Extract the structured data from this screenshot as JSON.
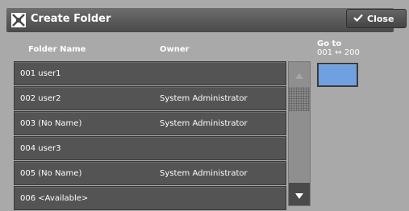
{
  "window": {
    "title": "Create Folder"
  },
  "toolbar": {
    "close_label": "Close"
  },
  "columns": {
    "folder_name": "Folder Name",
    "owner": "Owner"
  },
  "goto": {
    "label": "Go to",
    "range": "001 ↔ 200"
  },
  "folders": [
    {
      "name": "001  user1",
      "owner": ""
    },
    {
      "name": "002  user2",
      "owner": "System Administrator"
    },
    {
      "name": "003  (No Name)",
      "owner": "System Administrator"
    },
    {
      "name": "004  user3",
      "owner": ""
    },
    {
      "name": "005  (No Name)",
      "owner": "System Administrator"
    },
    {
      "name": "006  <Available>",
      "owner": ""
    }
  ],
  "icons": {
    "title": "create-folder-icon",
    "close": "checkmark-icon",
    "scroll_up": "triangle-up-icon",
    "scroll_down": "triangle-down-icon"
  },
  "colors": {
    "background": "#a9a9a9",
    "row": "#545454",
    "goto_button": "#6fa0e0"
  }
}
